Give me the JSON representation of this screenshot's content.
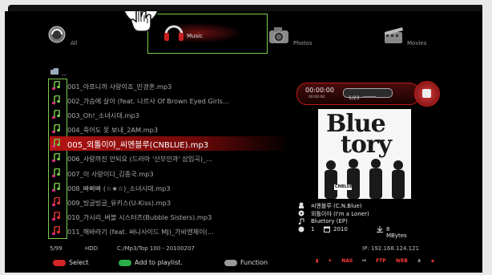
{
  "nav": {
    "all": "All",
    "music": "Music",
    "photos": "Photos",
    "movies": "Movies"
  },
  "path_dots": "..",
  "tracks": [
    "001_아프니까 사랑이죠_민경훈.mp3",
    "002_가슴에 살아 (feat. 나르사 Of Brown Eyed Girls...",
    "003_Oh!_소녀시대.mp3",
    "004_죽어도 못 보내_2AM.mp3",
    "005_외톨이야_씨엔블루(CNBLUE).mp3",
    "006_사랑까진 안되요 (드라마 '산부인과' 삽입곡)_...",
    "007_이 사랑이다_김종국.mp3",
    "008_빠빠빠 (☆★☆)_소녀시대.mp3",
    "009_빙글빙글_유키스(U-Kiss).mp3",
    "010_가시리_버블 시스터즈(Bubble Sisters).mp3",
    "011_해바라기 (feat. 써니사이드 MJ)_가비엔제이(..."
  ],
  "active_index": 4,
  "player": {
    "time": "00:00:00",
    "time_small": "00:00:00",
    "repeat_label": "1/23"
  },
  "album": {
    "title_line1": "Blue",
    "title_line2": "tory",
    "band_label": "CNBLUE"
  },
  "info": {
    "artist": "씨엔블루 (C.N.Blue)",
    "song": "외톨이야 (I'm a Loner)",
    "album": "Bluetory (EP)",
    "track": "1",
    "year": "2010",
    "size": "8 MBytes"
  },
  "status": {
    "count": "5/99",
    "device": "HDD",
    "path": "C:/Mp3/Top 100 - 20100207",
    "ip": "IP: 192.168.124.121"
  },
  "legend": {
    "select": "Select",
    "add": "Add to playlist.",
    "function": "Function"
  },
  "sys": {
    "nas": "NAS",
    "ftp": "FTP",
    "web": "WEB"
  },
  "colors": {
    "accent_red": "#bb1a1a",
    "highlight_green": "#7cc94a",
    "background": "#000000"
  }
}
